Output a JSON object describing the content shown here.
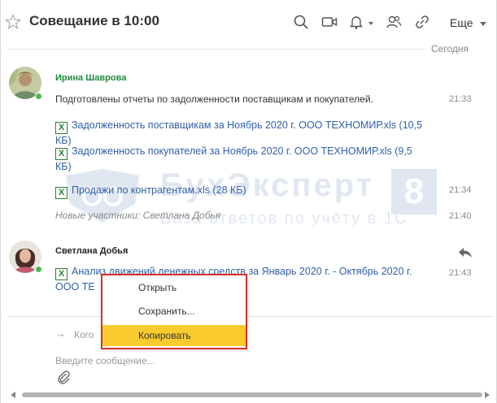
{
  "header": {
    "title": "Совещание в 10:00",
    "more_label": "Еще"
  },
  "date_divider": "Сегодня",
  "messages": [
    {
      "author": "Ирина Шаврова",
      "author_color": "#1e8a3c",
      "text": "Подготовлены отчеты по задолженности поставщикам и покупателей.",
      "time": "21:33",
      "files": [
        {
          "line1": "Задолженность поставщикам за Ноябрь 2020 г. ООО  ТЕХНОМИР.xls (10,5",
          "line2": "КБ)"
        },
        {
          "line1": "Задолженность покупателей за Ноябрь 2020 г. ООО  ТЕХНОМИР.xls (9,5",
          "line2": "КБ)"
        },
        {
          "line1": "Продажи по контрагентам.xls (28 КБ)",
          "line2": "",
          "time": "21:34"
        }
      ]
    },
    {
      "system_note": "Новые участники: Светлана Добья",
      "time": "21:40"
    },
    {
      "author": "Светлана Добья",
      "author_color": "#222222",
      "time": "21:43",
      "files": [
        {
          "line1": "Анализ движений денежных средств за Январь 2020 г. - Октябрь 2020 г.",
          "line2": "ООО  ТЕ"
        }
      ]
    }
  ],
  "watermark": {
    "title": "БухЭксперт",
    "subtitle": "База ответов по учёту в 1С",
    "number": "8"
  },
  "composer": {
    "whom_label": "Кого",
    "placeholder": "Введите сообщение..."
  },
  "context_menu": {
    "items": [
      {
        "label": "Открыть"
      },
      {
        "label": "Сохранить..."
      },
      {
        "label": "Копировать"
      }
    ],
    "highlight_color": "#f9cb2e",
    "frame_color": "#d9312b"
  },
  "file_icon_letter": "X"
}
